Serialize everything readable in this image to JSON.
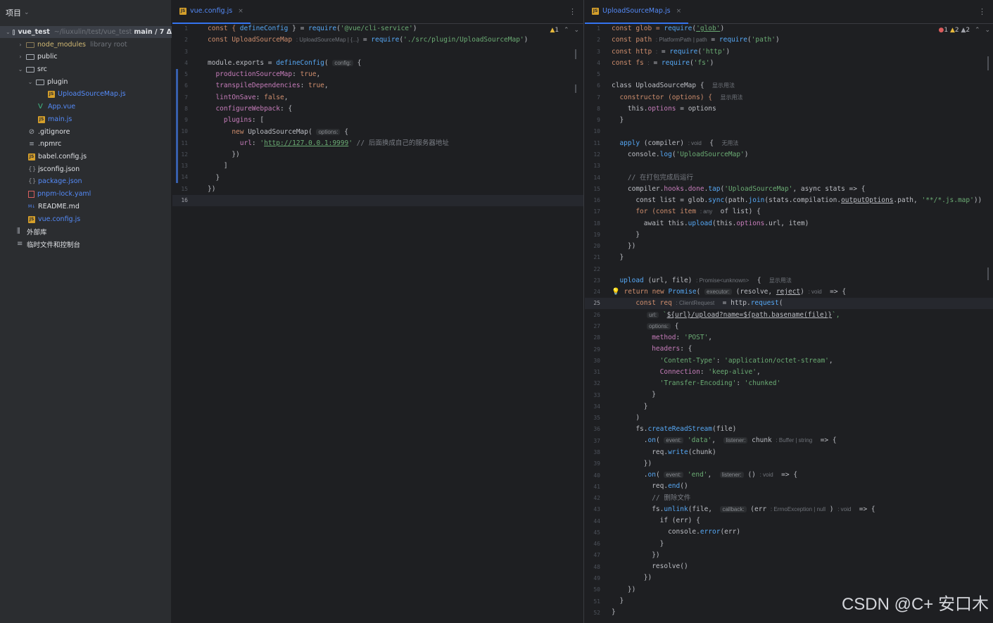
{
  "project": {
    "title": "项目",
    "root_name": "vue_test",
    "root_path": "~/liuxulin/test/vue_test",
    "root_branch": "main / 7 Δ",
    "items": [
      {
        "label": "node_modules",
        "hint": "library root"
      },
      {
        "label": "public"
      },
      {
        "label": "src"
      },
      {
        "label": "plugin"
      },
      {
        "label": "UploadSourceMap.js"
      },
      {
        "label": "App.vue"
      },
      {
        "label": "main.js"
      },
      {
        "label": ".gitignore"
      },
      {
        "label": ".npmrc"
      },
      {
        "label": "babel.config.js"
      },
      {
        "label": "jsconfig.json"
      },
      {
        "label": "package.json"
      },
      {
        "label": "pnpm-lock.yaml"
      },
      {
        "label": "README.md"
      },
      {
        "label": "vue.config.js"
      },
      {
        "label": "外部库"
      },
      {
        "label": "临时文件和控制台"
      }
    ]
  },
  "left_editor": {
    "tab": "vue.config.js",
    "inspections": {
      "warnings": "1"
    },
    "line_numbers": [
      "1",
      "2",
      "3",
      "4",
      "5",
      "6",
      "7",
      "8",
      "9",
      "10",
      "11",
      "12",
      "13",
      "14",
      "15",
      "16"
    ],
    "current_line": "16",
    "tokens": {
      "l1_a": "const { ",
      "l1_b": "defineConfig",
      "l1_c": " } = ",
      "l1_d": "require",
      "l1_e": "(",
      "l1_f": "'@vue/cli-service'",
      "l1_g": ")",
      "l2_a": "const UploadSourceMap ",
      "l2_hint": ": UploadSourceMap | {...}",
      "l2_b": " = ",
      "l2_c": "require",
      "l2_d": "(",
      "l2_e": "'./src/plugin/UploadSourceMap'",
      "l2_f": ")",
      "l4_a": "module.exports = ",
      "l4_b": "defineConfig",
      "l4_c": "( ",
      "l4_hint": "config:",
      "l4_d": " {",
      "l5_a": "  productionSourceMap",
      "l5_b": ": ",
      "l5_c": "true",
      "l5_d": ",",
      "l6_a": "  transpileDependencies",
      "l6_b": ": ",
      "l6_c": "true",
      "l6_d": ",",
      "l7_a": "  lintOnSave",
      "l7_b": ": ",
      "l7_c": "false",
      "l7_d": ",",
      "l8_a": "  configureWebpack",
      "l8_b": ": {",
      "l9_a": "    plugins",
      "l9_b": ": [",
      "l10_a": "      new ",
      "l10_b": "UploadSourceMap",
      "l10_c": "( ",
      "l10_hint": "options:",
      "l10_d": " {",
      "l11_a": "        url",
      "l11_b": ": ",
      "l11_c": "'",
      "l11_d": "http://127.0.0.1:9999",
      "l11_e": "'",
      "l11_f": " // 后面换成自己的服务器地址",
      "l12": "      })",
      "l13": "    ]",
      "l14": "  }",
      "l15": "})"
    }
  },
  "right_editor": {
    "tab": "UploadSourceMap.js",
    "inspections": {
      "errors": "1",
      "warnings": "2",
      "weak_warnings": "2"
    },
    "line_numbers": [
      "1",
      "2",
      "3",
      "4",
      "5",
      "6",
      "7",
      "8",
      "9",
      "10",
      "11",
      "12",
      "13",
      "14",
      "15",
      "16",
      "17",
      "18",
      "19",
      "20",
      "21",
      "22",
      "23",
      "24",
      "25",
      "26",
      "27",
      "28",
      "29",
      "30",
      "31",
      "32",
      "33",
      "34",
      "35",
      "36",
      "37",
      "38",
      "39",
      "40",
      "41",
      "42",
      "43",
      "44",
      "45",
      "46",
      "47",
      "48",
      "49",
      "50",
      "51",
      "52"
    ],
    "current_line": "25",
    "tokens": {
      "r1_a": "const glob = ",
      "r1_b": "require",
      "r1_c": "(",
      "r1_d": "'glob'",
      "r1_e": ")",
      "r2_a": "const path ",
      "r2_hint": ": PlatformPath | path",
      "r2_b": " = ",
      "r2_c": "require",
      "r2_d": "(",
      "r2_e": "'path'",
      "r2_f": ")",
      "r3_a": "const http ",
      "r3_hint": ":",
      "r3_b": " = ",
      "r3_c": "require",
      "r3_d": "(",
      "r3_e": "'http'",
      "r3_f": ")",
      "r4_a": "const fs ",
      "r4_hint": ":",
      "r4_b": " = ",
      "r4_c": "require",
      "r4_d": "(",
      "r4_e": "'fs'",
      "r4_f": ")",
      "r6_a": "class UploadSourceMap {",
      "r6_hint": "显示用法",
      "r7_a": "  constructor (options) {",
      "r7_hint": "显示用法",
      "r8_a": "    this.",
      "r8_b": "options",
      "r8_c": " = options",
      "r9": "  }",
      "r11_a": "  apply",
      "r11_b": " (compiler) ",
      "r11_hint": ": void",
      "r11_c": "  {",
      "r11_hint2": "无用法",
      "r12_a": "    console.",
      "r12_b": "log",
      "r12_c": "(",
      "r12_d": "'UploadSourceMap'",
      "r12_e": ")",
      "r14": "    // 在打包完成后运行",
      "r15_a": "    compiler.",
      "r15_b": "hooks",
      "r15_c": ".",
      "r15_d": "done",
      "r15_e": ".",
      "r15_f": "tap",
      "r15_g": "(",
      "r15_h": "'UploadSourceMap'",
      "r15_i": ", async stats => {",
      "r16_a": "      const list = glob.",
      "r16_b": "sync",
      "r16_c": "(path.",
      "r16_d": "join",
      "r16_e": "(stats.compilation.",
      "r16_f": "outputOptions",
      "r16_g": ".path, ",
      "r16_h": "'**/*.js.map'",
      "r16_i": "))",
      "r17_a": "      for (const item ",
      "r17_hint": ": any",
      "r17_b": "  of list) {",
      "r18_a": "        await this.",
      "r18_b": "upload",
      "r18_c": "(this.",
      "r18_d": "options",
      "r18_e": ".url, item)",
      "r19": "      }",
      "r20": "    })",
      "r21": "  }",
      "r23_a": "  upload",
      "r23_b": " (url, file) ",
      "r23_hint": ": Promise<unknown>",
      "r23_c": "  {",
      "r23_hint2": "显示用法",
      "r24_bulb": "💡",
      "r24_a": "return new ",
      "r24_b": "Promise",
      "r24_c": "( ",
      "r24_hint": "executor:",
      "r24_d": " (resolve, ",
      "r24_e": "reject",
      "r24_f": ") ",
      "r24_hint2": ": void",
      "r24_g": "  => {",
      "r25_a": "      const req ",
      "r25_hint": ": ClientRequest",
      "r25_b": "  = http.",
      "r25_c": "request",
      "r25_d": "(",
      "r26_hint": "url:",
      "r26_a": " `",
      "r26_b": "${url}/upload?name=${path.basename(file)}",
      "r26_c": "`,",
      "r27_hint": "options:",
      "r27_a": " {",
      "r28_a": "          method",
      "r28_b": ": ",
      "r28_c": "'POST'",
      "r28_d": ",",
      "r29_a": "          headers",
      "r29_b": ": {",
      "r30_a": "            ",
      "r30_b": "'Content-Type'",
      "r30_c": ": ",
      "r30_d": "'application/octet-stream'",
      "r30_e": ",",
      "r31_a": "            Connection",
      "r31_b": ": ",
      "r31_c": "'keep-alive'",
      "r31_d": ",",
      "r32_a": "            ",
      "r32_b": "'Transfer-Encoding'",
      "r32_c": ": ",
      "r32_d": "'chunked'",
      "r33": "          }",
      "r34": "        }",
      "r35": "      )",
      "r36_a": "      fs.",
      "r36_b": "createReadStream",
      "r36_c": "(file)",
      "r37_a": "        .",
      "r37_b": "on",
      "r37_c": "( ",
      "r37_hint": "event:",
      "r37_d": " ",
      "r37_e": "'data'",
      "r37_f": ",  ",
      "r37_hint2": "listener:",
      "r37_g": " chunk ",
      "r37_hint3": ": Buffer | string",
      "r37_h": "  => {",
      "r38_a": "          req.",
      "r38_b": "write",
      "r38_c": "(chunk)",
      "r39": "        })",
      "r40_a": "        .",
      "r40_b": "on",
      "r40_c": "( ",
      "r40_hint": "event:",
      "r40_d": " ",
      "r40_e": "'end'",
      "r40_f": ",  ",
      "r40_hint2": "listener:",
      "r40_g": " () ",
      "r40_hint3": ": void",
      "r40_h": "  => {",
      "r41_a": "          req.",
      "r41_b": "end",
      "r41_c": "()",
      "r42": "          // 删除文件",
      "r43_a": "          fs.",
      "r43_b": "unlink",
      "r43_c": "(file,  ",
      "r43_hint": "callback:",
      "r43_d": " (err ",
      "r43_hint2": ": ErrnoException | null",
      "r43_e": " ) ",
      "r43_hint3": ": void",
      "r43_f": "  => {",
      "r44": "            if (err) {",
      "r45_a": "              console.",
      "r45_b": "error",
      "r45_c": "(err)",
      "r46": "            }",
      "r47": "          })",
      "r48": "          resolve()",
      "r49": "        })",
      "r50": "    })",
      "r51": "  }",
      "r52": "}"
    }
  },
  "watermark": "CSDN @C+  安口木"
}
